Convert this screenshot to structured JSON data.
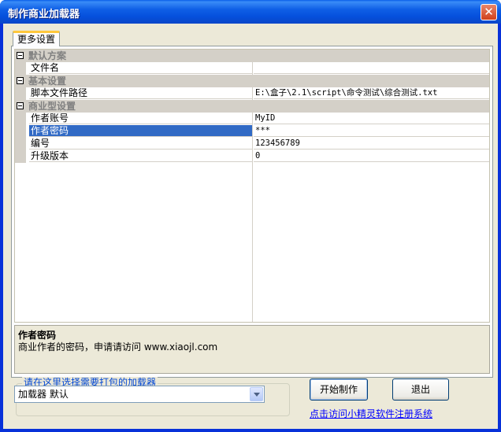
{
  "window": {
    "title": "制作商业加载器",
    "close_label": "✕"
  },
  "tab": {
    "label": "更多设置"
  },
  "property_grid": {
    "categories": [
      {
        "label": "默认方案",
        "items": [
          {
            "name": "文件名",
            "value": ""
          }
        ]
      },
      {
        "label": "基本设置",
        "items": [
          {
            "name": "脚本文件路径",
            "value": "E:\\盒子\\2.1\\script\\命令测试\\综合测试.txt"
          }
        ]
      },
      {
        "label": "商业型设置",
        "items": [
          {
            "name": "作者账号",
            "value": "MyID"
          },
          {
            "name": "作者密码",
            "value": "***",
            "selected": true
          },
          {
            "name": "编号",
            "value": "123456789"
          },
          {
            "name": "升级版本",
            "value": "0"
          }
        ]
      }
    ]
  },
  "help": {
    "title": "作者密码",
    "description": "商业作者的密码，申请请访问 www.xiaojl.com"
  },
  "loader_group": {
    "legend": "请在这里选择需要打包的加载器",
    "selected": "加载器 默认"
  },
  "buttons": {
    "start": "开始制作",
    "exit": "退出"
  },
  "link": {
    "register": "点击访问小精灵软件注册系统"
  }
}
